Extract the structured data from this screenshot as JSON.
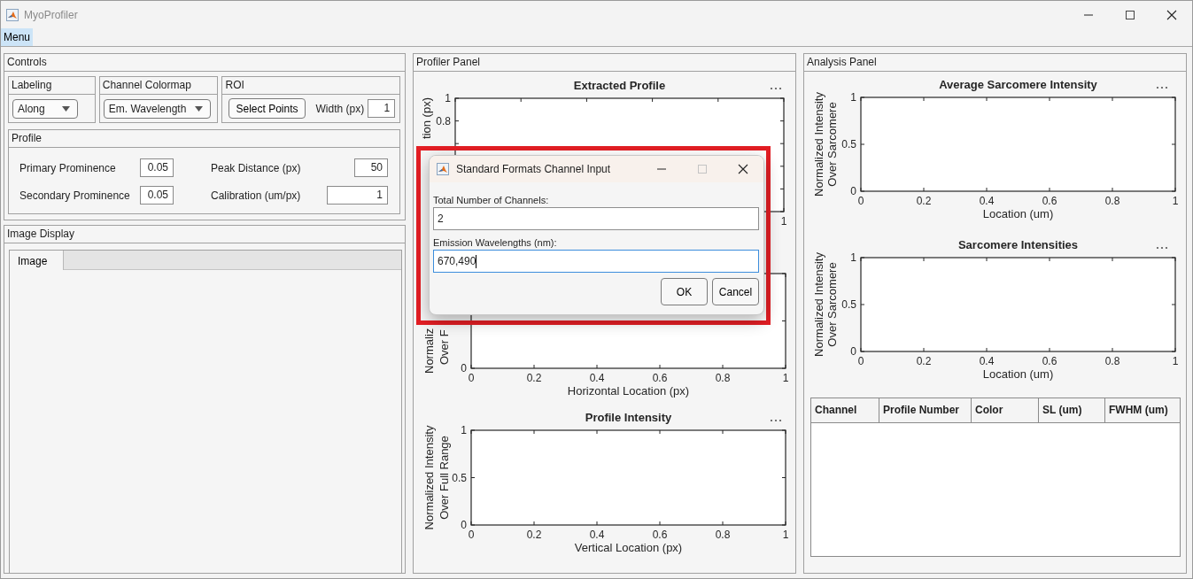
{
  "window": {
    "title": "MyoProfiler"
  },
  "menu": [
    {
      "label": "Menu",
      "selected": true
    }
  ],
  "controls": {
    "title": "Controls",
    "labeling": {
      "title": "Labeling",
      "value": "Along"
    },
    "colormap": {
      "title": "Channel Colormap",
      "value": "Em. Wavelength"
    },
    "roi": {
      "title": "ROI",
      "button": "Select Points",
      "width_label": "Width (px)",
      "width_value": "1"
    },
    "profile": {
      "title": "Profile",
      "fields": [
        {
          "label": "Primary Prominence",
          "value": "0.05"
        },
        {
          "label": "Peak Distance (px)",
          "value": "50"
        },
        {
          "label": "Secondary Prominence",
          "value": "0.05"
        },
        {
          "label": "Calibration (um/px)",
          "value": "1"
        }
      ]
    }
  },
  "image_display": {
    "title": "Image Display",
    "tabs": [
      {
        "label": "Image",
        "selected": true
      }
    ]
  },
  "profiler_panel": {
    "title": "Profiler Panel",
    "charts": [
      {
        "title": "Extracted Profile",
        "ylabel": "tion (px)",
        "x_tick_labels": [
          "1"
        ],
        "y_tick_labels": [
          "1",
          "0.8"
        ]
      },
      {
        "xlabel": "Horizontal Location (px)",
        "ylabel": "Normaliz\nOver F",
        "x_tick_labels": [
          "0",
          "0.2",
          "0.4",
          "0.6",
          "0.8",
          "1"
        ],
        "y_tick_labels": [
          "0"
        ]
      },
      {
        "title": "Profile Intensity",
        "xlabel": "Vertical Location (px)",
        "ylabel": "Normalized Intensity\nOver Full Range",
        "x_tick_labels": [
          "0",
          "0.2",
          "0.4",
          "0.6",
          "0.8",
          "1"
        ],
        "y_tick_labels": [
          "1",
          "0.5",
          "0"
        ]
      }
    ]
  },
  "analysis_panel": {
    "title": "Analysis Panel",
    "charts": [
      {
        "title": "Average Sarcomere Intensity",
        "xlabel": "Location (um)",
        "ylabel": "Normalized Intensity\nOver Sarcomere",
        "x_tick_labels": [
          "0",
          "0.2",
          "0.4",
          "0.6",
          "0.8",
          "1"
        ],
        "y_tick_labels": [
          "1",
          "0.5",
          "0"
        ]
      },
      {
        "title": "Sarcomere Intensities",
        "xlabel": "Location (um)",
        "ylabel": "Normalized Intensity\nOver Sarcomere",
        "x_tick_labels": [
          "0",
          "0.2",
          "0.4",
          "0.6",
          "0.8",
          "1"
        ],
        "y_tick_labels": [
          "1",
          "0.5",
          "0"
        ]
      }
    ],
    "table": {
      "columns": [
        "Channel",
        "Profile Number",
        "Color",
        "SL (um)",
        "FWHM (um)"
      ]
    }
  },
  "dialog": {
    "title": "Standard Formats Channel Input",
    "fields": [
      {
        "label": "Total Number of Channels:",
        "value": "2",
        "focused": false
      },
      {
        "label": "Emission Wavelengths (nm):",
        "value": "670,490",
        "focused": true
      }
    ],
    "buttons": [
      "OK",
      "Cancel"
    ],
    "maximize_disabled": true
  }
}
